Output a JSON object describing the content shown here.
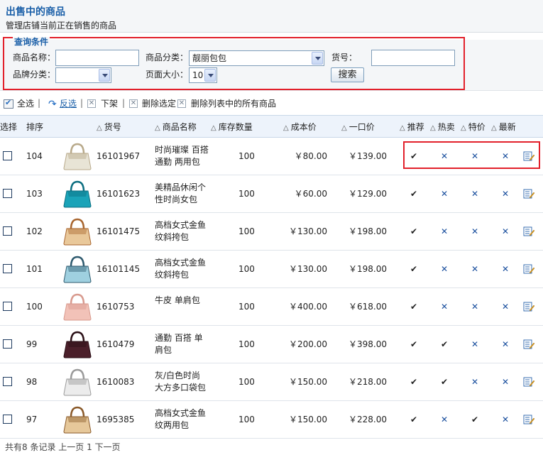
{
  "page": {
    "title": "出售中的商品",
    "subtitle": "管理店铺当前正在销售的商品"
  },
  "query": {
    "legend": "查询条件",
    "name_label": "商品名称：",
    "name_value": "",
    "category_label": "商品分类：",
    "category_value": "靓丽包包",
    "sku_label": "货号：",
    "sku_value": "",
    "brand_label": "品牌分类：",
    "brand_value": "",
    "pagesize_label": "页面大小：",
    "pagesize_value": "10",
    "search_button": "搜索"
  },
  "toolbar": {
    "select_all": "全选",
    "invert": "反选",
    "unlist": "下架",
    "delete_selected": "删除选定",
    "delete_all": "删除列表中的所有商品",
    "separator": "|"
  },
  "columns": {
    "select": "选择",
    "order": "排序",
    "sku": "货号",
    "name": "商品名称",
    "stock": "库存数量",
    "cost": "成本价",
    "price": "一口价",
    "recommend": "推荐",
    "hot": "热卖",
    "special": "特价",
    "new": "最新"
  },
  "rows": [
    {
      "order": "104",
      "sku": "16101967",
      "name1": "时尚璀璨 百搭",
      "name2": "通勤 两用包",
      "stock": "100",
      "cost": "￥80.00",
      "price": "￥139.00",
      "recommend": "yes",
      "hot": "no",
      "special": "no",
      "new": "no",
      "bag_color": "#e8e4d6",
      "bag_trim": "#b8a98a"
    },
    {
      "order": "103",
      "sku": "16101623",
      "name1": "美精品休闲个",
      "name2": "性时尚女包",
      "stock": "100",
      "cost": "￥60.00",
      "price": "￥129.00",
      "recommend": "yes",
      "hot": "no",
      "special": "no",
      "new": "no",
      "bag_color": "#1aa3b8",
      "bag_trim": "#0c6e80"
    },
    {
      "order": "102",
      "sku": "16101475",
      "name1": "高档女式金鱼",
      "name2": "纹斜挎包",
      "stock": "100",
      "cost": "￥130.00",
      "price": "￥198.00",
      "recommend": "yes",
      "hot": "no",
      "special": "no",
      "new": "no",
      "bag_color": "#e9c89a",
      "bag_trim": "#a8652e"
    },
    {
      "order": "101",
      "sku": "16101145",
      "name1": "高档女式金鱼",
      "name2": "纹斜挎包",
      "stock": "100",
      "cost": "￥130.00",
      "price": "￥198.00",
      "recommend": "yes",
      "hot": "no",
      "special": "no",
      "new": "no",
      "bag_color": "#9fd0e0",
      "bag_trim": "#2e5a6e"
    },
    {
      "order": "100",
      "sku": "1610753",
      "name1": "牛皮 单肩包",
      "name2": "",
      "stock": "100",
      "cost": "￥400.00",
      "price": "￥618.00",
      "recommend": "yes",
      "hot": "no",
      "special": "no",
      "new": "no",
      "bag_color": "#f2c2b8",
      "bag_trim": "#d89a8e"
    },
    {
      "order": "99",
      "sku": "1610479",
      "name1": "通勤 百搭 单",
      "name2": "肩包",
      "stock": "100",
      "cost": "￥200.00",
      "price": "￥398.00",
      "recommend": "yes",
      "hot": "yes",
      "special": "no",
      "new": "no",
      "bag_color": "#4b1f2a",
      "bag_trim": "#2a0f16"
    },
    {
      "order": "98",
      "sku": "1610083",
      "name1": "灰/白色时尚",
      "name2": "大方多口袋包",
      "stock": "100",
      "cost": "￥150.00",
      "price": "￥218.00",
      "recommend": "yes",
      "hot": "yes",
      "special": "no",
      "new": "no",
      "bag_color": "#ececec",
      "bag_trim": "#9a9a9a"
    },
    {
      "order": "97",
      "sku": "1695385",
      "name1": "高档女式金鱼",
      "name2": "纹两用包",
      "stock": "100",
      "cost": "￥150.00",
      "price": "￥228.00",
      "recommend": "yes",
      "hot": "no",
      "special": "yes",
      "new": "no",
      "bag_color": "#e6c89a",
      "bag_trim": "#8a5a2a"
    }
  ],
  "marks": {
    "yes": "✔",
    "no": "✕"
  },
  "footer": "共有8 条记录 上一页 1 下一页"
}
